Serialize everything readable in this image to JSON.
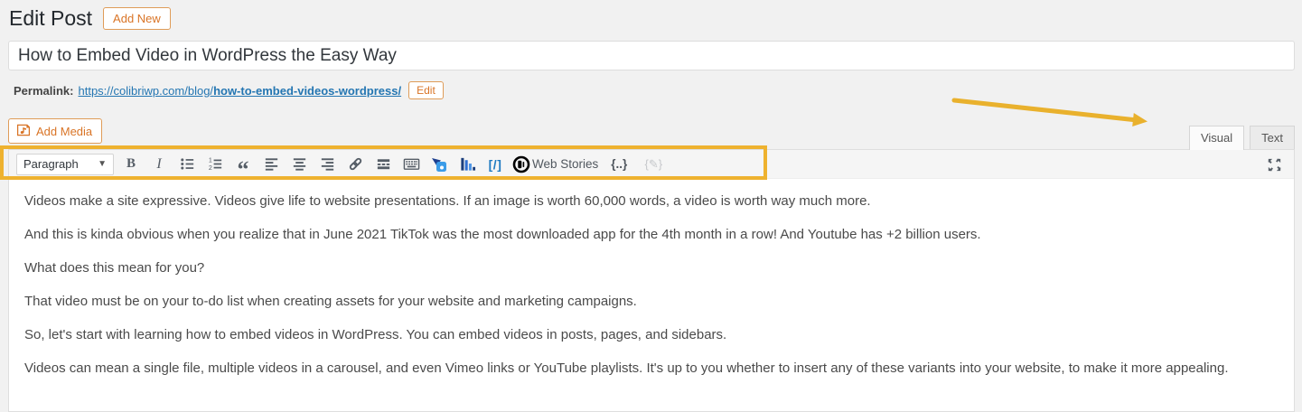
{
  "page": {
    "heading": "Edit Post",
    "add_new_label": "Add New"
  },
  "title_field": {
    "value": "How to Embed Video in WordPress the Easy Way"
  },
  "permalink": {
    "label": "Permalink:",
    "url_base": "https://colibriwp.com/blog/",
    "url_slug": "how-to-embed-videos-wordpress/",
    "edit_label": "Edit"
  },
  "editor": {
    "add_media_label": "Add Media",
    "tabs": [
      {
        "label": "Visual",
        "active": true
      },
      {
        "label": "Text",
        "active": false
      }
    ],
    "toolbar": {
      "format_select_value": "Paragraph",
      "web_stories_label": "Web Stories",
      "button_names": [
        "Bold",
        "Italic",
        "Bulleted list",
        "Numbered list",
        "Blockquote",
        "Align left",
        "Align center",
        "Align right",
        "Insert/edit link",
        "Insert Read More tag",
        "Toolbar Toggle",
        "Plugin insert",
        "Insert chart",
        "Insert shortcode",
        "Web Stories",
        "Insert code snippet",
        "Edit code snippet",
        "Fullscreen"
      ]
    },
    "paragraphs": [
      "Videos make a site expressive. Videos give life to website presentations. If an image is worth 60,000 words, a video is worth way much more.",
      "And this is kinda obvious when you realize that in June 2021 TikTok was the most downloaded app for the 4th month in a row! And Youtube has +2 billion users.",
      "What does this mean for you?",
      "That video must be on your to-do list when creating assets for your website and marketing campaigns.",
      "So, let's start with learning how to embed videos in WordPress. You can embed videos in posts, pages, and sidebars.",
      "Videos can mean a single file, multiple videos in a carousel, and even Vimeo links or YouTube playlists. It's up to you whether to insert any of these variants into your website, to make it more appealing."
    ]
  },
  "icons": {
    "select_caret": "▼",
    "bold": "B",
    "italic": "I",
    "blockquote": "“",
    "shortcode": "[/]",
    "code_snippet": "{..}",
    "code_edit": "{✎}"
  },
  "colors": {
    "accent_orange": "#d97426",
    "link_blue": "#2476b2",
    "annotation_yellow": "#eeb22f",
    "icon_gray": "#555d66",
    "plugin_blue": "#2f6fd0",
    "webstories_black": "#000000"
  }
}
